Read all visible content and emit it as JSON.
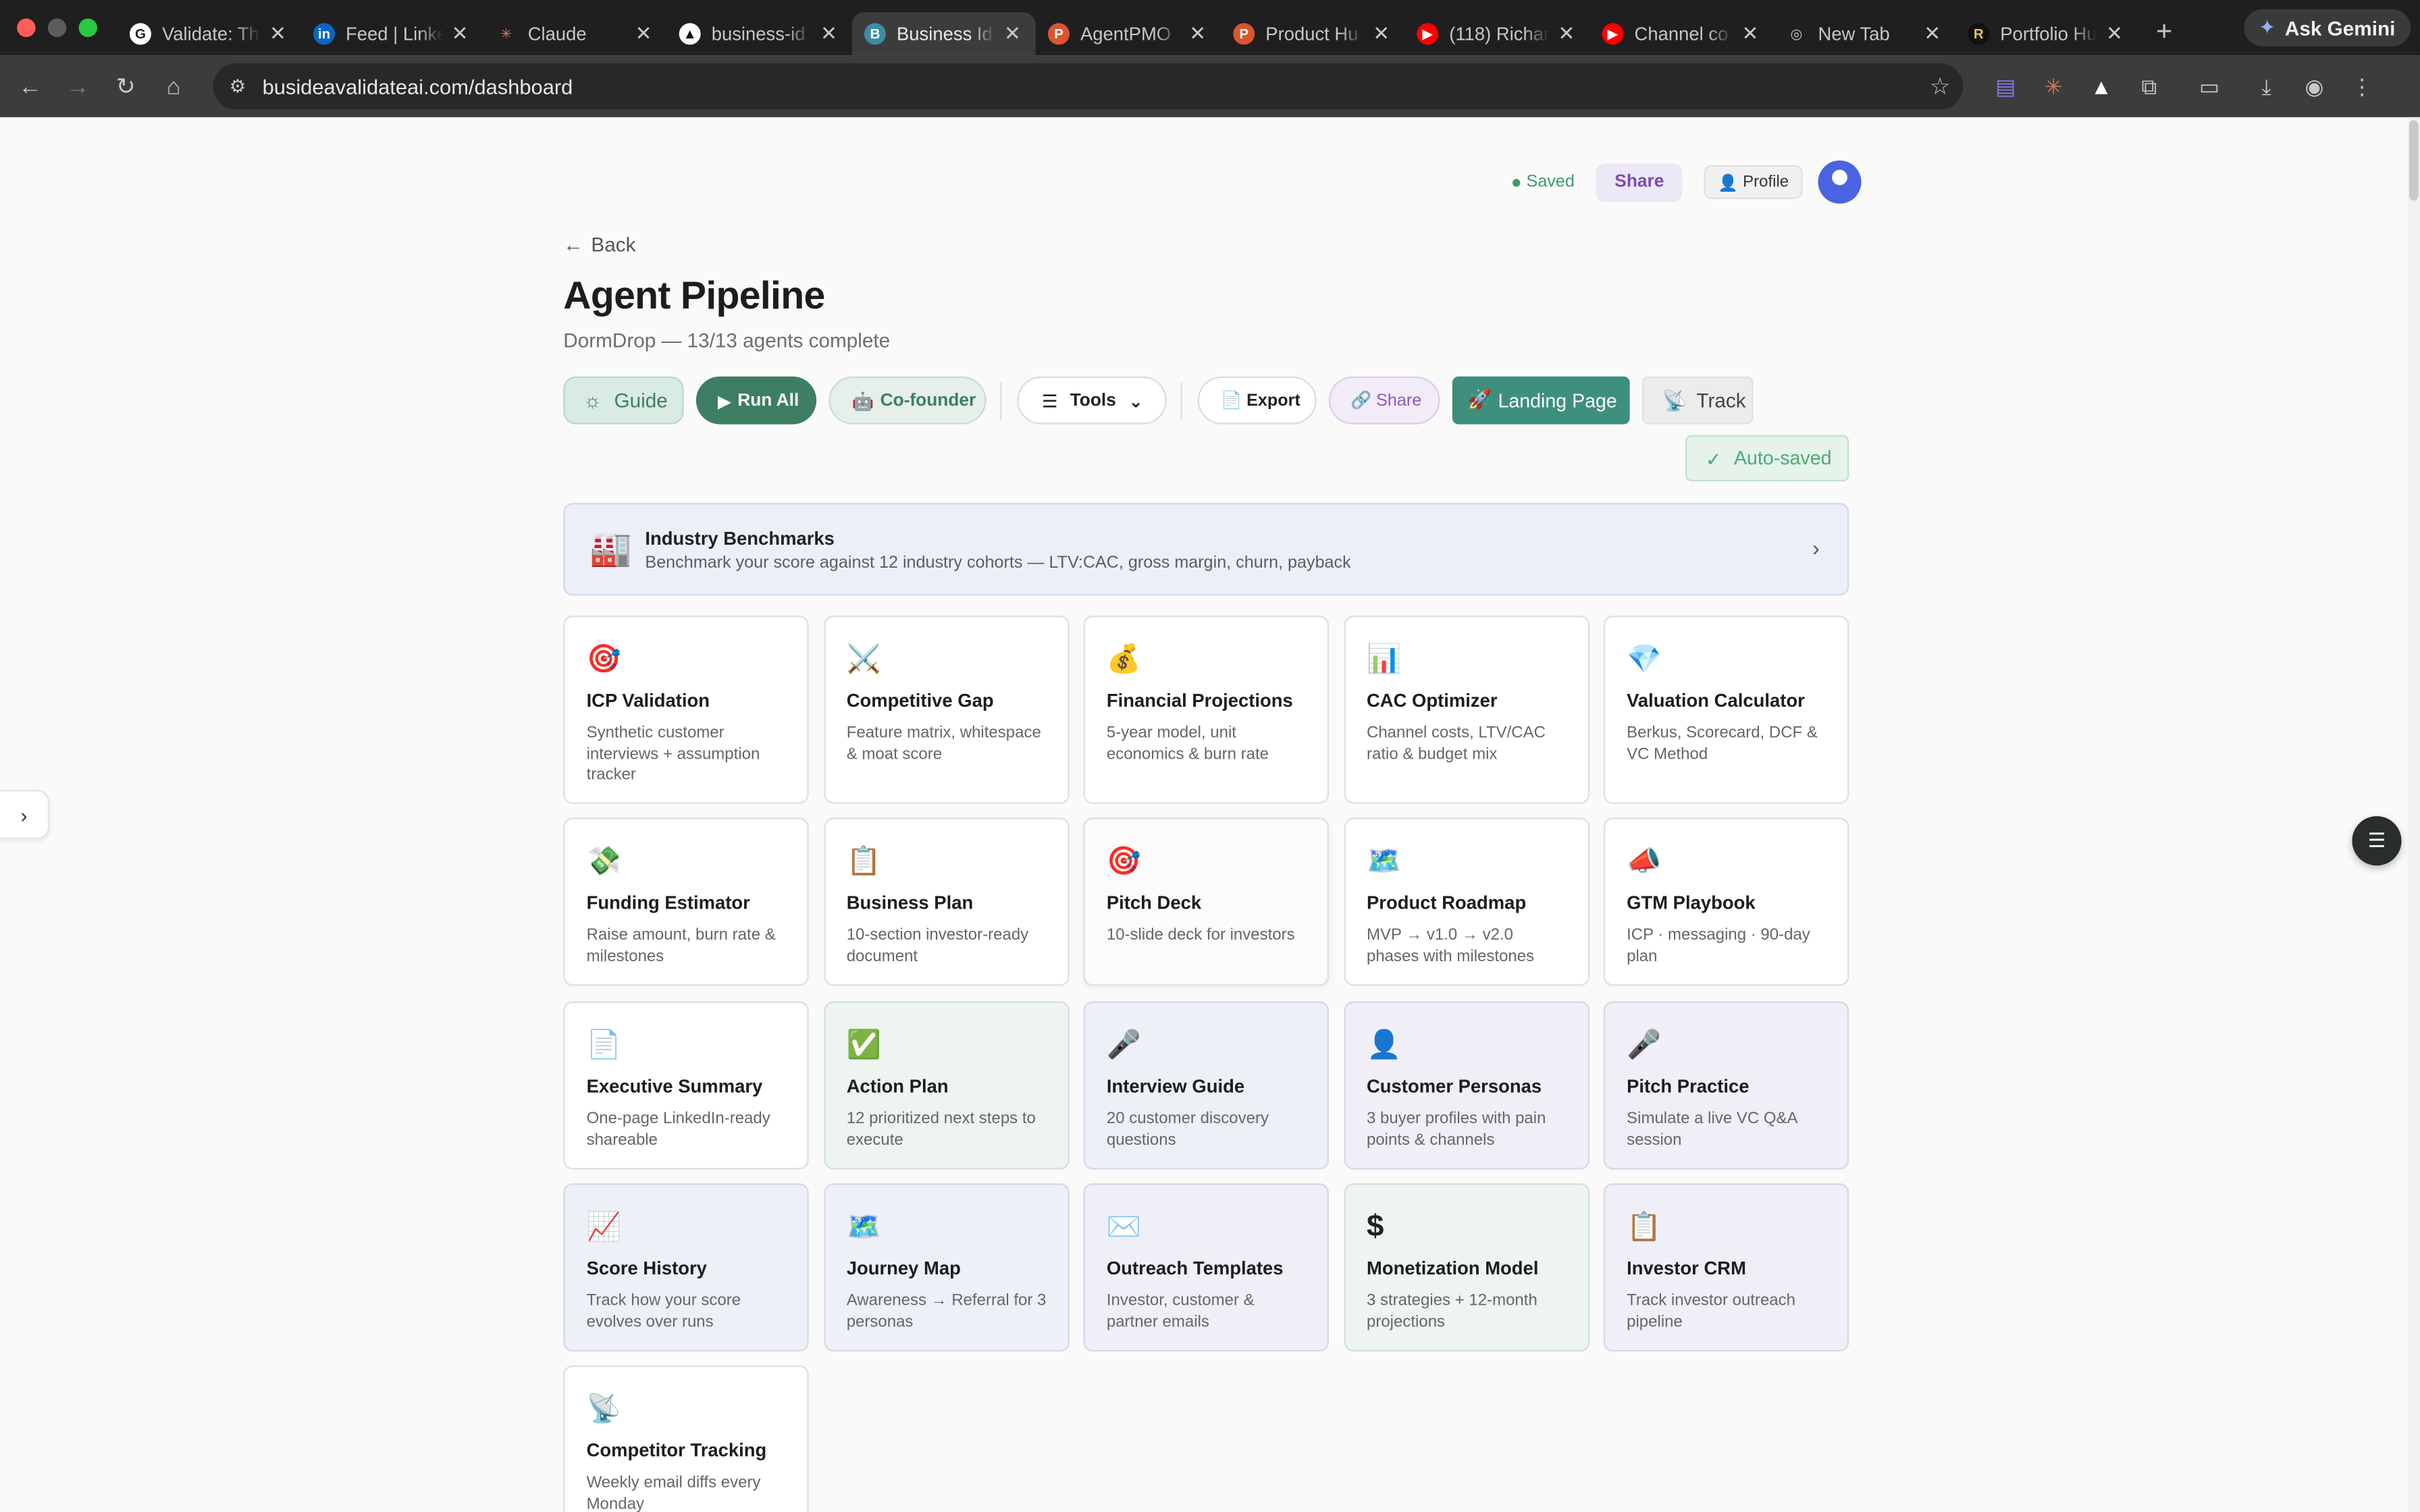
{
  "browser": {
    "tabs": [
      {
        "title": "Validate: Th",
        "fav": "G",
        "favBg": "#ffffff",
        "favColor": "#1f1f1f"
      },
      {
        "title": "Feed | Linke",
        "fav": "in",
        "favBg": "#0a66c2",
        "favColor": "#ffffff"
      },
      {
        "title": "Claude",
        "fav": "✳",
        "favBg": "transparent",
        "favColor": "#d97757"
      },
      {
        "title": "business-id",
        "fav": "▲",
        "favBg": "#ffffff",
        "favColor": "#111111"
      },
      {
        "title": "Business Id",
        "fav": "B",
        "favBg": "#3b8ea5",
        "favColor": "#ffffff",
        "active": true
      },
      {
        "title": "AgentPMO",
        "fav": "P",
        "favBg": "#da552f",
        "favColor": "#ffffff"
      },
      {
        "title": "Product Hu",
        "fav": "P",
        "favBg": "#da552f",
        "favColor": "#ffffff"
      },
      {
        "title": "(118) Richar",
        "fav": "▶",
        "favBg": "#ff0000",
        "favColor": "#ffffff"
      },
      {
        "title": "Channel co",
        "fav": "▶",
        "favBg": "#ff0000",
        "favColor": "#ffffff"
      },
      {
        "title": "New Tab",
        "fav": "◎",
        "favBg": "transparent",
        "favColor": "#c7c7c7"
      },
      {
        "title": "Portfolio Hu",
        "fav": "R",
        "favBg": "#111111",
        "favColor": "#e8c25a"
      }
    ],
    "gemini_label": "Ask Gemini",
    "url": "busideavalidateai.com/dashboard"
  },
  "header": {
    "saved_label": "Saved",
    "share_label": "Share",
    "profile_label": "Profile"
  },
  "back_label": "Back",
  "title": "Agent Pipeline",
  "subtitle": "DormDrop — 13/13 agents complete",
  "actions": {
    "guide": "Guide",
    "run_all": "Run All",
    "cofounder": "Co-founder",
    "tools": "Tools",
    "export": "Export",
    "share": "Share",
    "landing": "Landing Page",
    "track": "Track"
  },
  "autosaved_label": "Auto-saved",
  "benchmarks": {
    "icon": "🏭",
    "title": "Industry Benchmarks",
    "desc": "Benchmark your score against 12 industry cohorts — LTV:CAC, gross margin, churn, payback"
  },
  "cards": [
    {
      "icon": "🎯",
      "title": "ICP Validation",
      "desc": "Synthetic customer interviews + assumption tracker",
      "style": "white"
    },
    {
      "icon": "⚔️",
      "title": "Competitive Gap",
      "desc": "Feature matrix, whitespace & moat score",
      "style": "white"
    },
    {
      "icon": "💰",
      "title": "Financial Projections",
      "desc": "5-year model, unit economics & burn rate",
      "style": "white"
    },
    {
      "icon": "📊",
      "title": "CAC Optimizer",
      "desc": "Channel costs, LTV/CAC ratio & budget mix",
      "style": "white"
    },
    {
      "icon": "💎",
      "title": "Valuation Calculator",
      "desc": "Berkus, Scorecard, DCF & VC Method",
      "style": "white"
    },
    {
      "icon": "💸",
      "title": "Funding Estimator",
      "desc": "Raise amount, burn rate & milestones",
      "style": "white"
    },
    {
      "icon": "📋",
      "title": "Business Plan",
      "desc": "10-section investor-ready document",
      "style": "white"
    },
    {
      "icon": "🎯",
      "title": "Pitch Deck",
      "desc": "10-slide deck for investors",
      "style": "white2"
    },
    {
      "icon": "🗺️",
      "title": "Product Roadmap",
      "desc": "MVP → v1.0 → v2.0 phases with milestones",
      "style": "white"
    },
    {
      "icon": "📣",
      "title": "GTM Playbook",
      "desc": "ICP · messaging · 90-day plan",
      "style": "white"
    },
    {
      "icon": "📄",
      "title": "Executive Summary",
      "desc": "One-page LinkedIn-ready shareable",
      "style": "white"
    },
    {
      "icon": "✅",
      "title": "Action Plan",
      "desc": "12 prioritized next steps to execute",
      "style": "green"
    },
    {
      "icon": "🎤",
      "title": "Interview Guide",
      "desc": "20 customer discovery questions",
      "style": "blue"
    },
    {
      "icon": "👤",
      "title": "Customer Personas",
      "desc": "3 buyer profiles with pain points & channels",
      "style": "purple"
    },
    {
      "icon": "🎤",
      "title": "Pitch Practice",
      "desc": "Simulate a live VC Q&A session",
      "style": "purple"
    },
    {
      "icon": "📈",
      "title": "Score History",
      "desc": "Track how your score evolves over runs",
      "style": "blue"
    },
    {
      "icon": "🗺️",
      "title": "Journey Map",
      "desc": "Awareness → Referral for 3 personas",
      "style": "blue"
    },
    {
      "icon": "✉️",
      "title": "Outreach Templates",
      "desc": "Investor, customer & partner emails",
      "style": "purple"
    },
    {
      "icon": "$",
      "title": "Monetization Model",
      "desc": "3 strategies + 12-month projections",
      "style": "green"
    },
    {
      "icon": "📋",
      "title": "Investor CRM",
      "desc": "Track investor outreach pipeline",
      "style": "purple"
    },
    {
      "icon": "📡",
      "title": "Competitor Tracking",
      "desc": "Weekly email diffs every Monday",
      "style": "white"
    }
  ]
}
